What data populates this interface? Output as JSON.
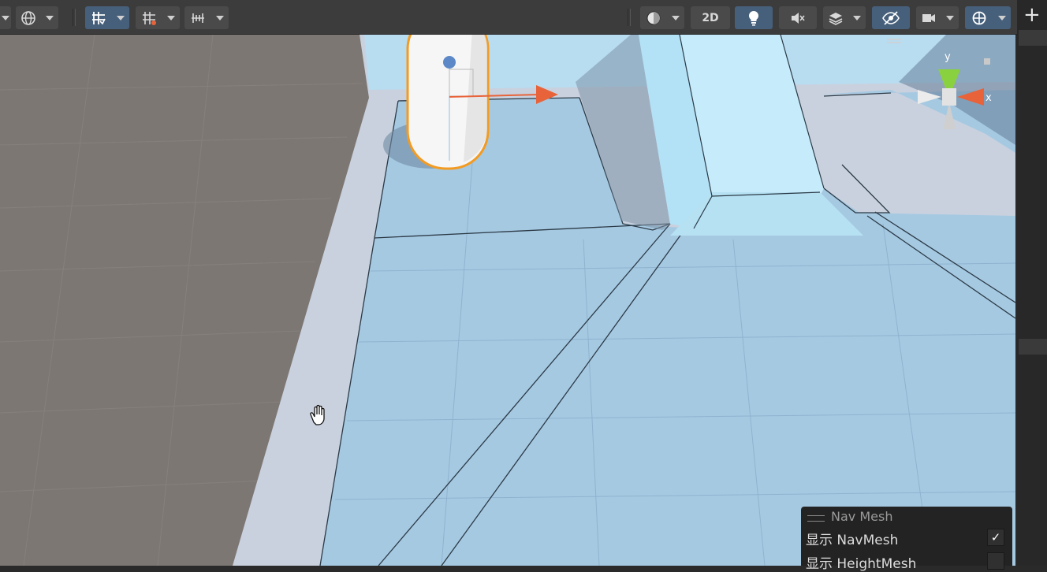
{
  "toolbar": {
    "left_tools": [
      {
        "name": "global-view-icon",
        "glyph": "🌐",
        "active": false
      },
      {
        "name": "grid-snap-icon",
        "glyph": "#",
        "active": true
      },
      {
        "name": "grid-visibility-icon",
        "glyph": "#",
        "active": false
      },
      {
        "name": "increment-snap-icon",
        "glyph": "┃┃┃",
        "active": false
      }
    ],
    "shading_mode": "shaded",
    "toggle_2d_label": "2D",
    "lighting_on": true,
    "audio_muted": true,
    "effects": "layers",
    "hidden_objects_toggle": "visibility-off",
    "camera": "camera",
    "gizmos": "gizmos"
  },
  "scene_view": {
    "selected_object": "capsule",
    "orientation_gizmo": {
      "y_label": "y",
      "x_label": "x"
    },
    "colors": {
      "floor": "#7d7773",
      "walkway": "#c5ccd9",
      "navmesh": "#a9cbe3",
      "selection": "#f39b21",
      "gizmo_x": "#e8633a",
      "gizmo_y": "#8ad13f"
    }
  },
  "navmesh_overlay": {
    "title": "Nav Mesh",
    "rows": [
      {
        "label": "显示 NavMesh",
        "checked": true
      },
      {
        "label": "显示 HeightMesh",
        "checked": false
      }
    ]
  },
  "right_panel": {
    "add_label": "+"
  }
}
